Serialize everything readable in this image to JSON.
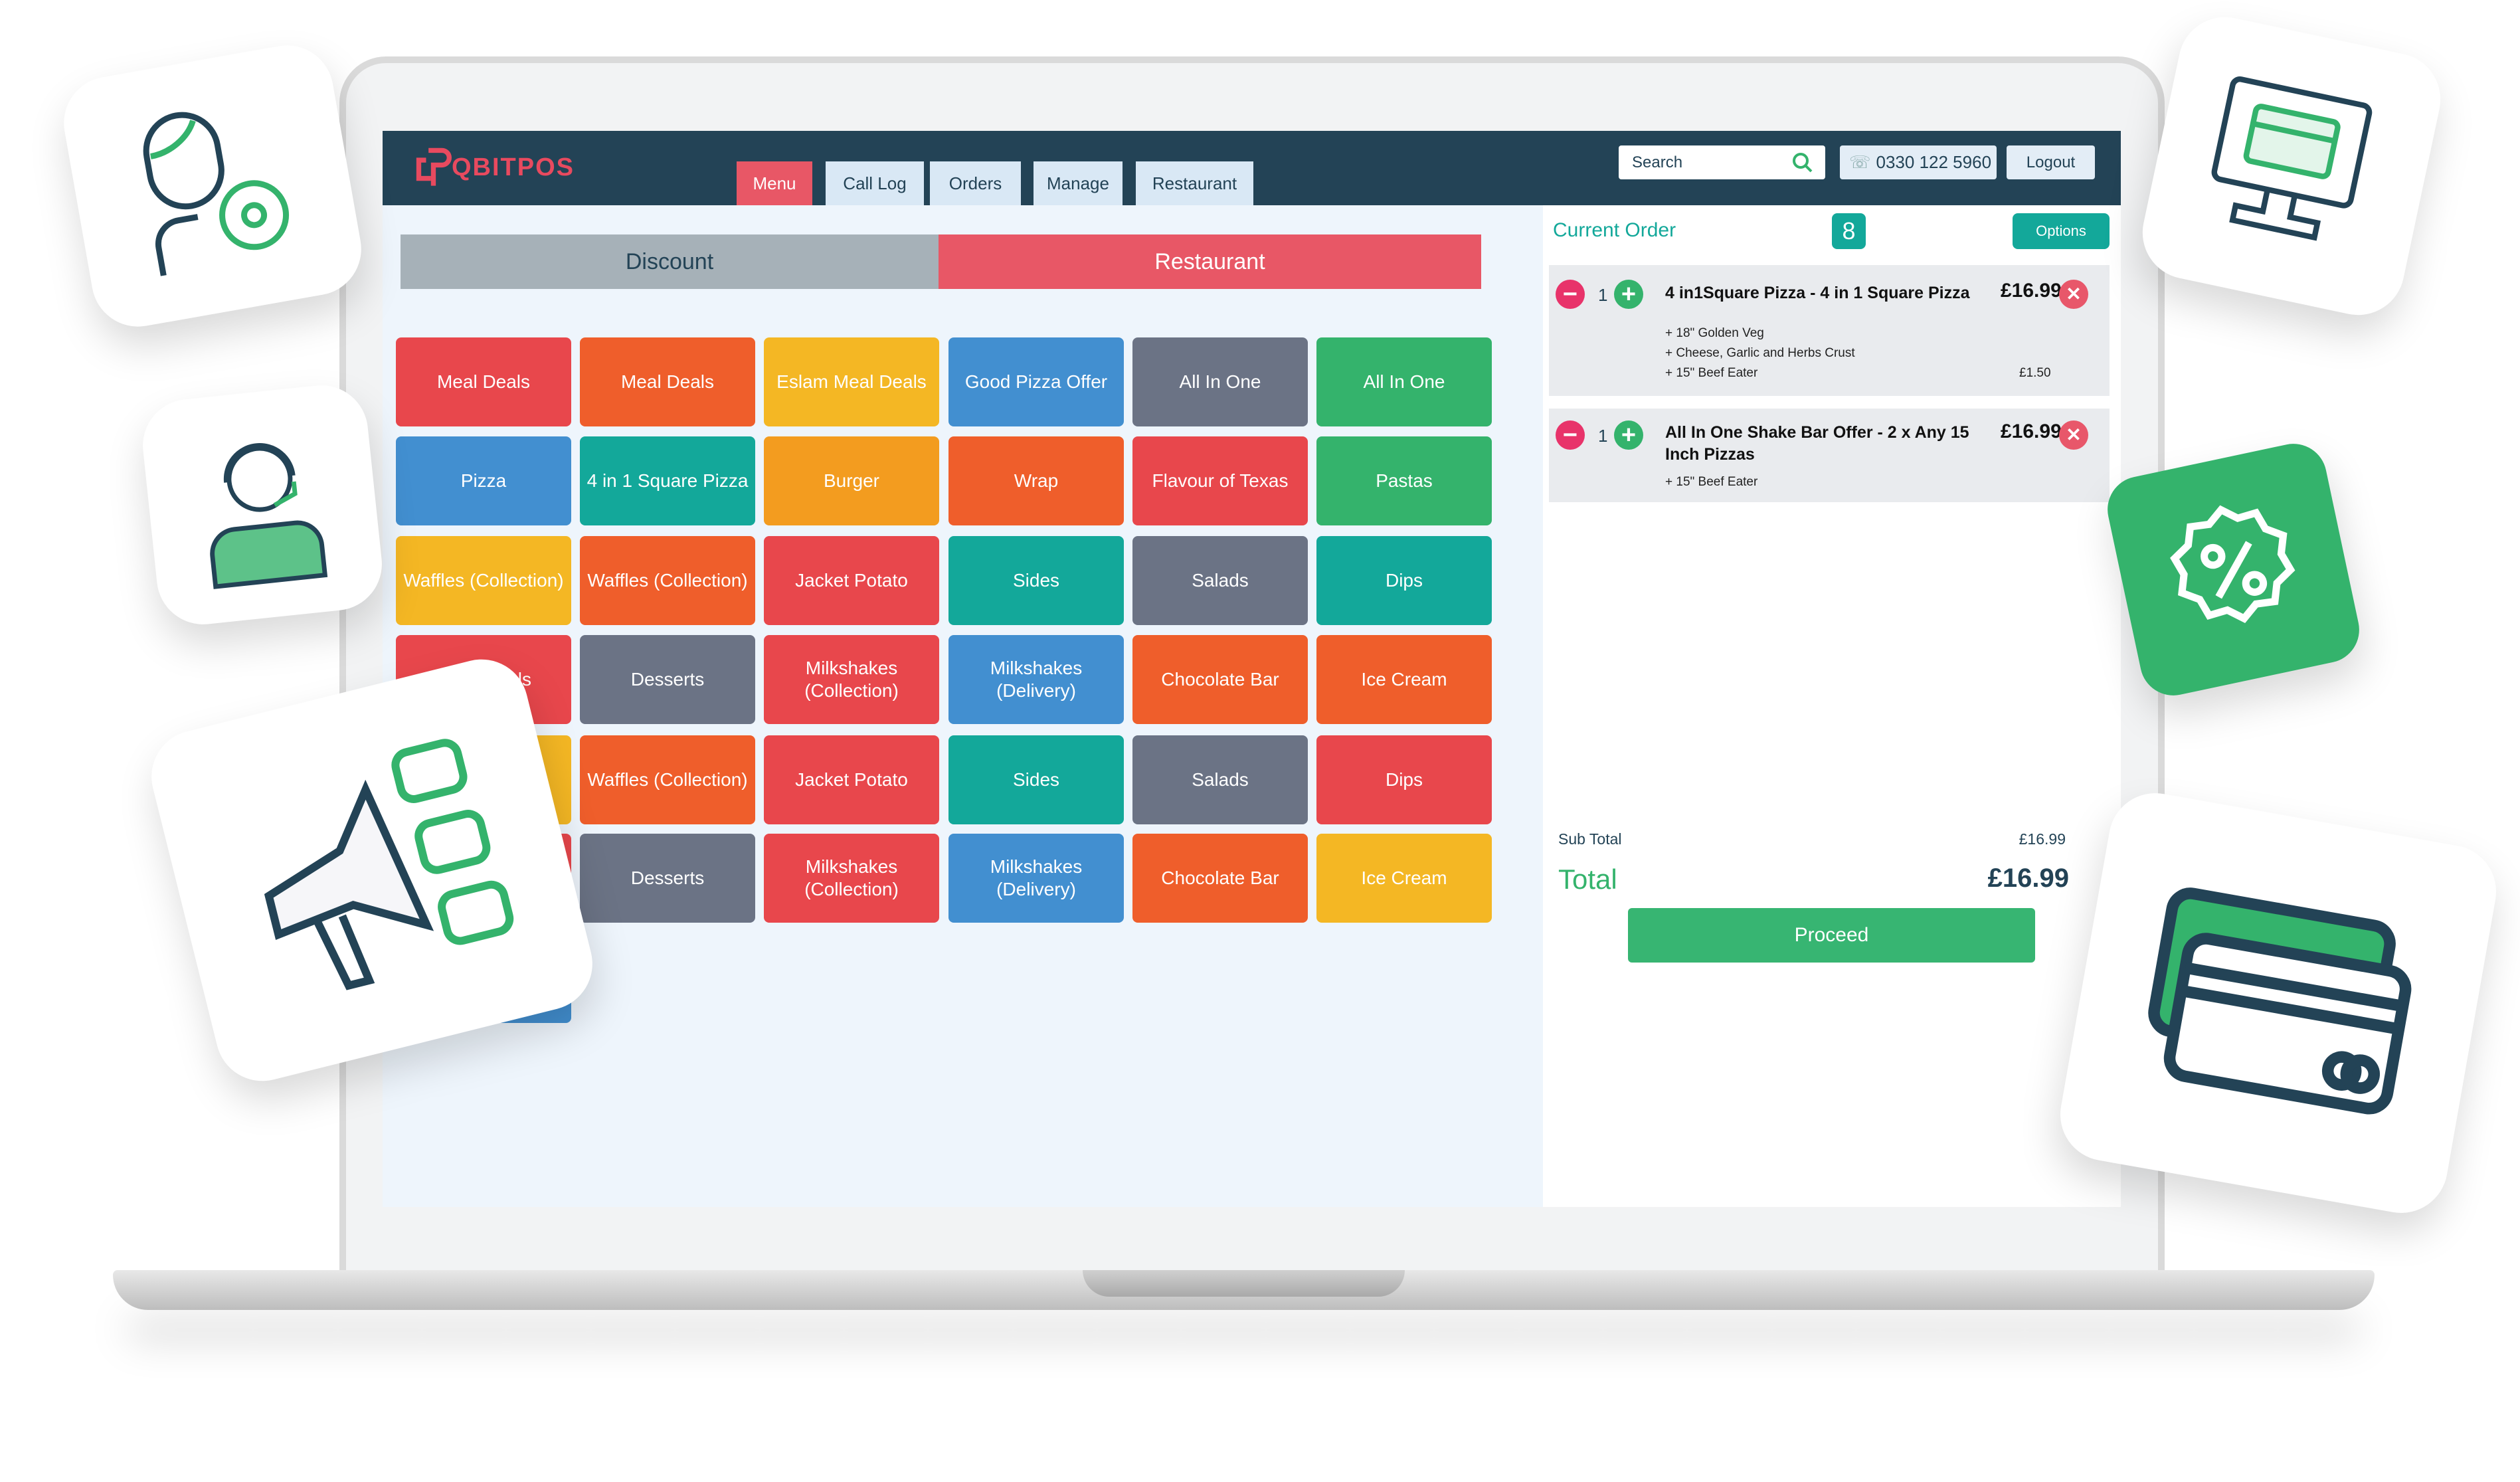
{
  "app": {
    "logo_text": "QBITPOS"
  },
  "nav": {
    "tabs": [
      {
        "label": "Menu",
        "active": true
      },
      {
        "label": "Call Log"
      },
      {
        "label": "Orders"
      },
      {
        "label": "Manage"
      },
      {
        "label": "Restaurant"
      }
    ]
  },
  "header": {
    "search_placeholder": "Search",
    "phone": "0330 122 5960",
    "logout": "Logout"
  },
  "category_bar": {
    "discount": "Discount",
    "restaurant": "Restaurant"
  },
  "colors": {
    "red": "#e8474c",
    "orange": "#ef5e2b",
    "yellow": "#f4b724",
    "amber": "#f39c1f",
    "blue": "#428fd0",
    "grey": "#6b7385",
    "green": "#34b36c",
    "teal": "#13a89a",
    "header": "#234356"
  },
  "tiles": [
    [
      {
        "label": "Meal Deals",
        "color": "red"
      },
      {
        "label": "Meal Deals",
        "color": "orange"
      },
      {
        "label": "Eslam Meal Deals",
        "color": "yellow"
      },
      {
        "label": "Good Pizza Offer",
        "color": "blue"
      },
      {
        "label": "All In One",
        "color": "grey"
      },
      {
        "label": "All In One",
        "color": "green"
      }
    ],
    [
      {
        "label": "Pizza",
        "color": "blue"
      },
      {
        "label": "4 in 1 Square Pizza",
        "color": "teal"
      },
      {
        "label": "Burger",
        "color": "amber"
      },
      {
        "label": "Wrap",
        "color": "orange"
      },
      {
        "label": "Flavour of Texas",
        "color": "red"
      },
      {
        "label": "Pastas",
        "color": "green"
      }
    ],
    [
      {
        "label": "Waffles (Collection)",
        "color": "yellow"
      },
      {
        "label": "Waffles (Collection)",
        "color": "orange"
      },
      {
        "label": "Jacket Potato",
        "color": "red"
      },
      {
        "label": "Sides",
        "color": "teal"
      },
      {
        "label": "Salads",
        "color": "grey"
      },
      {
        "label": "Dips",
        "color": "teal"
      }
    ],
    [
      {
        "label": "als",
        "color": "red"
      },
      {
        "label": "Desserts",
        "color": "grey"
      },
      {
        "label": "Milkshakes (Collection)",
        "color": "red"
      },
      {
        "label": "Milkshakes (Delivery)",
        "color": "blue"
      },
      {
        "label": "Chocolate Bar",
        "color": "orange"
      },
      {
        "label": "Ice Cream",
        "color": "orange"
      }
    ],
    [
      {
        "label": "",
        "color": "yellow"
      },
      {
        "label": "Waffles (Collection)",
        "color": "orange"
      },
      {
        "label": "Jacket Potato",
        "color": "red"
      },
      {
        "label": "Sides",
        "color": "teal"
      },
      {
        "label": "Salads",
        "color": "grey"
      },
      {
        "label": "Dips",
        "color": "red"
      }
    ],
    [
      {
        "label": "",
        "color": "red"
      },
      {
        "label": "Desserts",
        "color": "grey"
      },
      {
        "label": "Milkshakes (Collection)",
        "color": "red"
      },
      {
        "label": "Milkshakes (Delivery)",
        "color": "blue"
      },
      {
        "label": "Chocolate Bar",
        "color": "orange"
      },
      {
        "label": "Ice Cream",
        "color": "yellow"
      }
    ],
    [
      {
        "label": "",
        "color": "blue"
      }
    ]
  ],
  "order": {
    "title": "Current Order",
    "count": "8",
    "options": "Options",
    "items": [
      {
        "qty": "1",
        "name": "4 in1Square Pizza - 4 in 1 Square Pizza",
        "price": "£16.99",
        "modifiers": [
          "+ 18\" Golden Veg",
          "+ Cheese, Garlic and Herbs Crust",
          "+ 15\" Beef Eater"
        ],
        "modifier_price": "£1.50"
      },
      {
        "qty": "1",
        "name": "All In One Shake Bar Offer - 2 x Any 15 Inch Pizzas",
        "price": "£16.99",
        "modifiers": [
          "+ 15\" Beef Eater"
        ]
      }
    ],
    "subtotal_label": "Sub Total",
    "subtotal": "£16.99",
    "total_label": "Total",
    "total": "£16.99",
    "proceed": "Proceed"
  },
  "decorations": [
    "driver-icon",
    "support-agent-icon",
    "megaphone-icon",
    "pos-terminal-icon",
    "discount-badge-icon",
    "credit-card-icon"
  ]
}
